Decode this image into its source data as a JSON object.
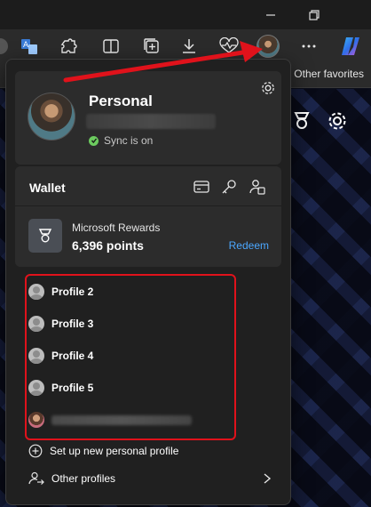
{
  "window": {
    "controls": {
      "minimize": "minimize-icon",
      "restore": "restore-icon"
    }
  },
  "toolbar": {
    "icons": [
      "reading-view-icon",
      "translate-icon",
      "extensions-icon",
      "split-screen-icon",
      "collections-icon",
      "downloads-icon",
      "performance-icon",
      "profile-avatar",
      "more-icon",
      "copilot-icon"
    ]
  },
  "favorites_bar": {
    "other_favorites": "Other favorites"
  },
  "profile_flyout": {
    "personal": {
      "name": "Personal",
      "sync_status": "Sync is on"
    },
    "wallet": {
      "title": "Wallet",
      "rewards_label": "Microsoft Rewards",
      "rewards_points": "6,396 points",
      "redeem_label": "Redeem"
    },
    "profiles": [
      {
        "label": "Profile 2"
      },
      {
        "label": "Profile 3"
      },
      {
        "label": "Profile 4"
      },
      {
        "label": "Profile 5"
      }
    ],
    "setup_new_label": "Set up new personal profile",
    "other_profiles_label": "Other profiles"
  },
  "colors": {
    "highlight_box": "#e0121b",
    "arrow": "#e0121b",
    "link": "#4ba7ff",
    "sync_ok": "#6ccb5f"
  }
}
